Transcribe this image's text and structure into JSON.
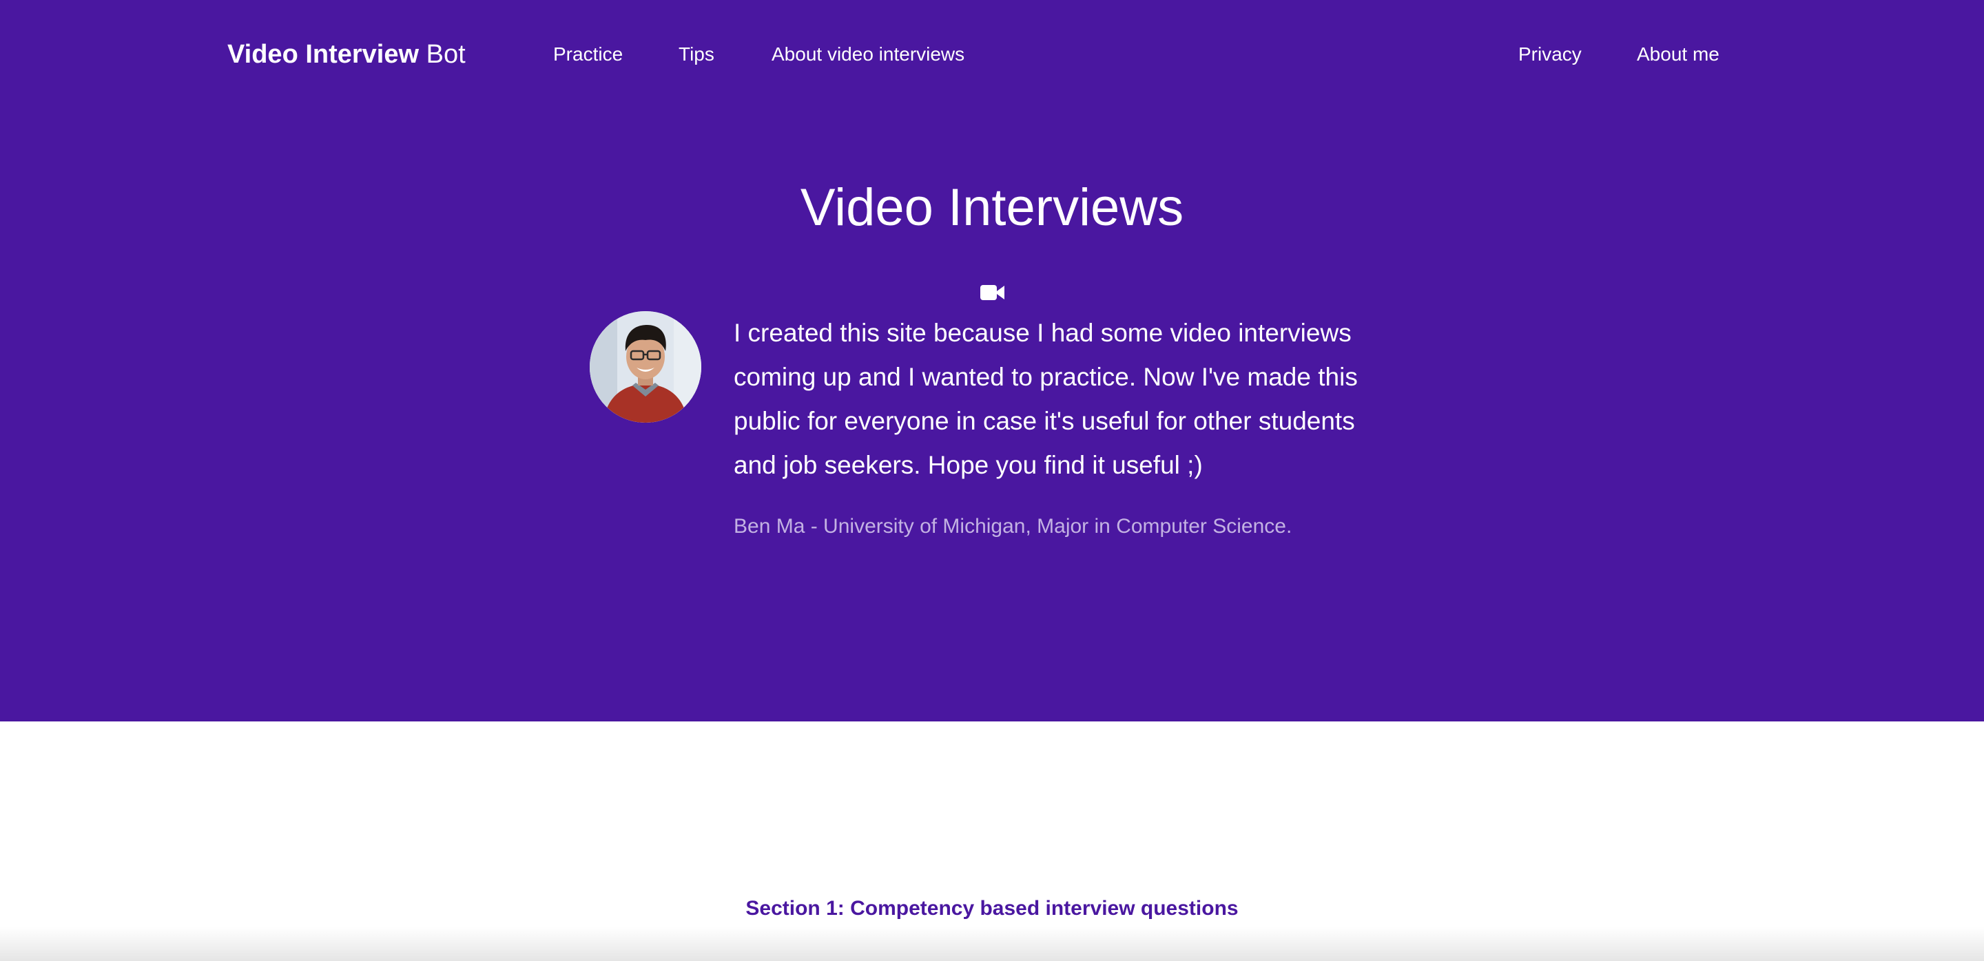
{
  "nav": {
    "brand_bold": "Video Interview",
    "brand_light": " Bot",
    "links_left": [
      {
        "label": "Practice"
      },
      {
        "label": "Tips"
      },
      {
        "label": "About video interviews"
      }
    ],
    "links_right": [
      {
        "label": "Privacy"
      },
      {
        "label": "About me"
      }
    ]
  },
  "hero": {
    "title": "Video Interviews",
    "icon": "video-camera-icon",
    "quote": "I created this site because I had some video interviews coming up and I wanted to practice. Now I've made this public for everyone in case it's useful for other students and job seekers. Hope you find it useful ;)",
    "attribution": "Ben Ma - University of Michigan, Major in Computer Science."
  },
  "content": {
    "section_link": "Section 1: Competency based interview questions"
  },
  "colors": {
    "hero_bg": "#4a17a0",
    "attribution_text": "#c3b2e3",
    "link_accent": "#4a17a0"
  }
}
